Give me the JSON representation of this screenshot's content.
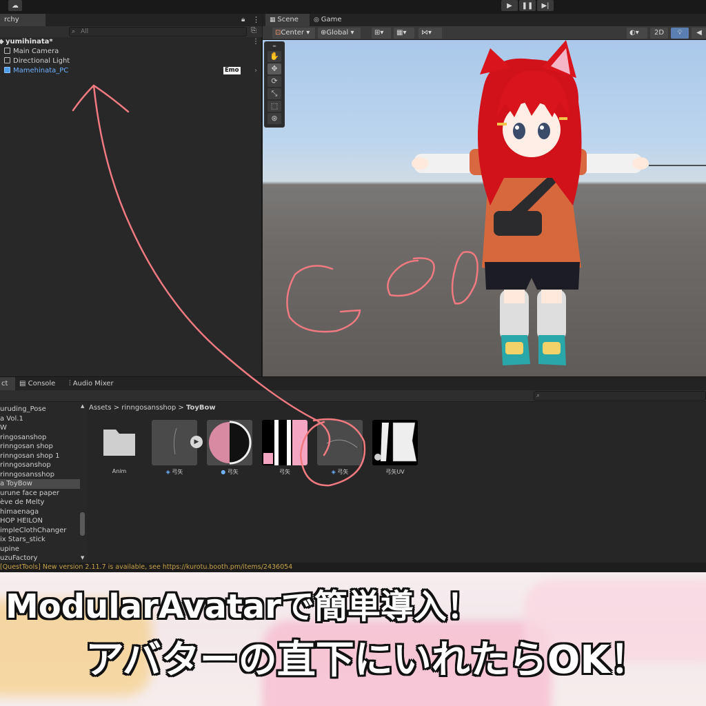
{
  "toolbar": {
    "play_icon": "play-icon",
    "pause_icon": "pause-icon",
    "step_icon": "step-icon",
    "cloud_icon": "cloud-icon"
  },
  "hierarchy": {
    "tab_label": "rchy",
    "search_placeholder": "All",
    "scene_name": "yumihinata*",
    "items": [
      {
        "label": "Main Camera"
      },
      {
        "label": "Directional Light"
      },
      {
        "label": "Mamehinata_PC",
        "badge": "Emo"
      }
    ]
  },
  "scene": {
    "tabs": [
      {
        "label": "Scene"
      },
      {
        "label": "Game"
      }
    ],
    "pivot_label": "Center",
    "space_label": "Global",
    "mode_2d_label": "2D",
    "annotation_text": "Go!"
  },
  "project": {
    "tabs": [
      {
        "label": "ct"
      },
      {
        "label": "Console"
      },
      {
        "label": "Audio Mixer"
      }
    ],
    "folders": [
      "uruding_Pose",
      "a Vol.1",
      "W",
      "ringosanshop",
      "rinngosan shop",
      "rinngosan shop 1",
      "rinngosanshop",
      "rinngosansshop",
      "a ToyBow",
      "urune face paper",
      "ève de Melty",
      "himaenaga",
      "HOP HEILON",
      "impleClothChanger",
      "ix Stars_stick",
      "upine",
      "uzuFactory"
    ],
    "breadcrumb": [
      "Assets",
      "rinngosansshop",
      "ToyBow"
    ],
    "assets": [
      {
        "label": "Anim",
        "type": "folder"
      },
      {
        "label": "弓矢",
        "type": "prefab"
      },
      {
        "label": "弓矢",
        "type": "material"
      },
      {
        "label": "弓矢",
        "type": "texture"
      },
      {
        "label": "弓矢",
        "type": "prefab"
      },
      {
        "label": "弓矢UV",
        "type": "texture"
      }
    ]
  },
  "status": {
    "message": "[QuestTools] New version 2.11.7 is available, see https://kurotu.booth.pm/items/2436054"
  },
  "caption": {
    "line1": "ModularAvatarで簡単導入！",
    "line2": "アバターの直下にいれたらOK！"
  },
  "colors": {
    "accent": "#f07a80",
    "selected_blue": "#6fb2ff",
    "status_yellow": "#c8a34a"
  }
}
